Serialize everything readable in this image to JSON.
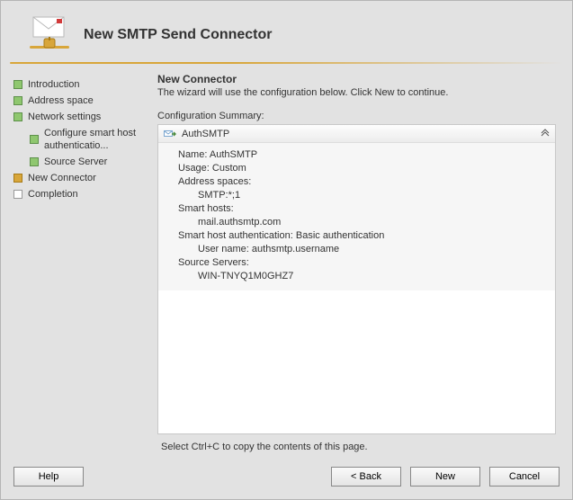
{
  "title": "New SMTP Send Connector",
  "sidebar": {
    "steps": [
      {
        "label": "Introduction",
        "state": "done"
      },
      {
        "label": "Address space",
        "state": "done"
      },
      {
        "label": "Network settings",
        "state": "done"
      },
      {
        "label": "Configure smart host authenticatio...",
        "state": "sub-done"
      },
      {
        "label": "Source Server",
        "state": "sub-done"
      },
      {
        "label": "New Connector",
        "state": "current"
      },
      {
        "label": "Completion",
        "state": "future"
      }
    ]
  },
  "main": {
    "heading": "New Connector",
    "description": "The wizard will use the configuration below.  Click New to continue.",
    "summaryLabel": "Configuration Summary:",
    "connectorName": "AuthSMTP",
    "details": {
      "nameLabel": "Name:",
      "nameValue": "AuthSMTP",
      "usageLabel": "Usage:",
      "usageValue": "Custom",
      "addrLabel": "Address spaces:",
      "addrValue": "SMTP:*;1",
      "hostsLabel": "Smart hosts:",
      "hostsValue": "mail.authsmtp.com",
      "authLabel": "Smart host authentication:",
      "authValue": "Basic authentication",
      "userLabel": "User name:",
      "userValue": "authsmtp.username",
      "srcLabel": "Source Servers:",
      "srcValue": "WIN-TNYQ1M0GHZ7"
    }
  },
  "hint": "Select Ctrl+C to copy the contents of this page.",
  "buttons": {
    "help": "Help",
    "back": "< Back",
    "new": "New",
    "cancel": "Cancel"
  }
}
